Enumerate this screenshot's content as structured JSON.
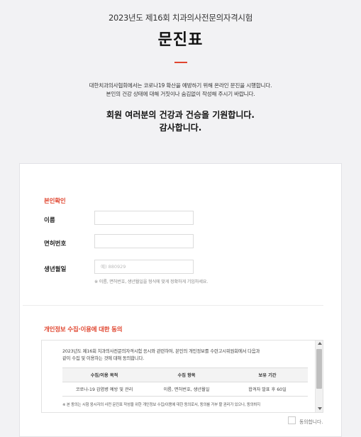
{
  "header": {
    "exam_title": "2023년도 제16회 치과의사전문의자격시험",
    "form_title": "문진표",
    "notice_line1": "대한치과의사협회에서는 코로나19 확산을 예방하기 위해 온라인 문진을 시행합니다.",
    "notice_line2": "본인의 건강 상태에 대해 거짓이나 숨김없이 작성해 주시기 바랍니다.",
    "wish_line1": "회원 여러분의 건강과 건승을 기원합니다.",
    "wish_line2": "감사합니다."
  },
  "identity": {
    "section_title": "본인확인",
    "name_label": "이름",
    "name_value": "",
    "license_label": "면허번호",
    "license_value": "",
    "birth_label": "생년월일",
    "birth_placeholder": "예) 880929",
    "hint": "※ 이름, 면허번호, 생년월일을 형식에 맞게 정확하게 기입하세요."
  },
  "privacy": {
    "section_title": "개인정보 수집·이용에 대한 동의",
    "terms_line1": "2023년도 제16회 치과의사전문의자격시험 응시와 관련하여, 본인의 개인정보를 수련고시위원회에서 다음과",
    "terms_line2": "같이 수집 및 이용하는 것에 대해 동의합니다.",
    "table_headers": [
      "수집/이용 목적",
      "수집 항목",
      "보유 기간"
    ],
    "table_rows": [
      [
        "코로나-19 감염병 예방 및 관리",
        "이름, 면허번호, 생년월일",
        "합격자 발표 후 60일"
      ]
    ],
    "note": "※ 본 동의는 시험 응시자의 사전 문진표 작성을 위한 개인정보 수집/이용에 대한 동의로서, 동의를 거부 할 권리가 있으나, 동의하지",
    "agree_label": "동의합니다.",
    "agree_checked": false
  },
  "colors": {
    "accent": "#e0452f",
    "background": "#f2f2f4",
    "card": "#ffffff"
  }
}
